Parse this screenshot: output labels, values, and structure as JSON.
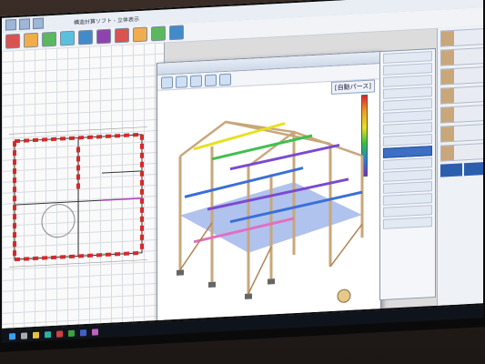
{
  "window": {
    "title": "構造計算ソフト - 立体表示"
  },
  "viewer": {
    "badge": "[自動パース]"
  },
  "icons": {
    "taskbar": [
      "windows-icon",
      "search-icon",
      "folder-icon",
      "edge-icon",
      "app-icon",
      "app-icon",
      "app-icon",
      "app-icon"
    ],
    "ribbon_colors": [
      "#d9534f",
      "#f0ad4e",
      "#5cb85c",
      "#5bc0de",
      "#428bca",
      "#8e44ad",
      "#d9534f",
      "#f0ad4e",
      "#5cb85c",
      "#428bca"
    ]
  },
  "colors": {
    "wall_red": "#d42a2a",
    "timber": "#c9a77a",
    "beam_purple": "#7a4ad0",
    "beam_blue": "#3a6fd8",
    "beam_green": "#3fbf4f",
    "beam_yellow": "#e8e020"
  }
}
